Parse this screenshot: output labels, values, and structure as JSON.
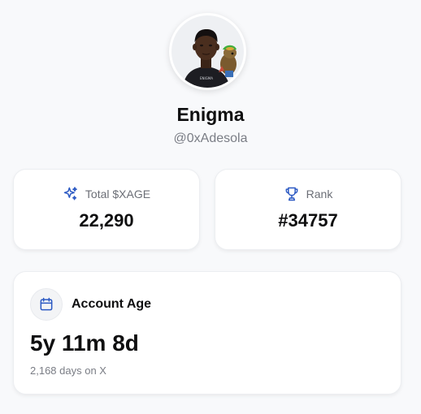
{
  "profile": {
    "name": "Enigma",
    "handle": "@0xAdesola",
    "avatar_shirt_text": "ENIGMA"
  },
  "stats": {
    "xage": {
      "label": "Total $XAGE",
      "value": "22,290",
      "icon": "sparkles-icon"
    },
    "rank": {
      "label": "Rank",
      "value": "#34757",
      "icon": "trophy-icon"
    }
  },
  "account_age": {
    "title": "Account Age",
    "value": "5y 11m 8d",
    "subtitle": "2,168 days on X",
    "icon": "calendar-icon"
  },
  "colors": {
    "accent_blue": "#2b59c3",
    "background": "#f8f9fb",
    "card": "#ffffff",
    "muted_text": "#7a7d85"
  }
}
